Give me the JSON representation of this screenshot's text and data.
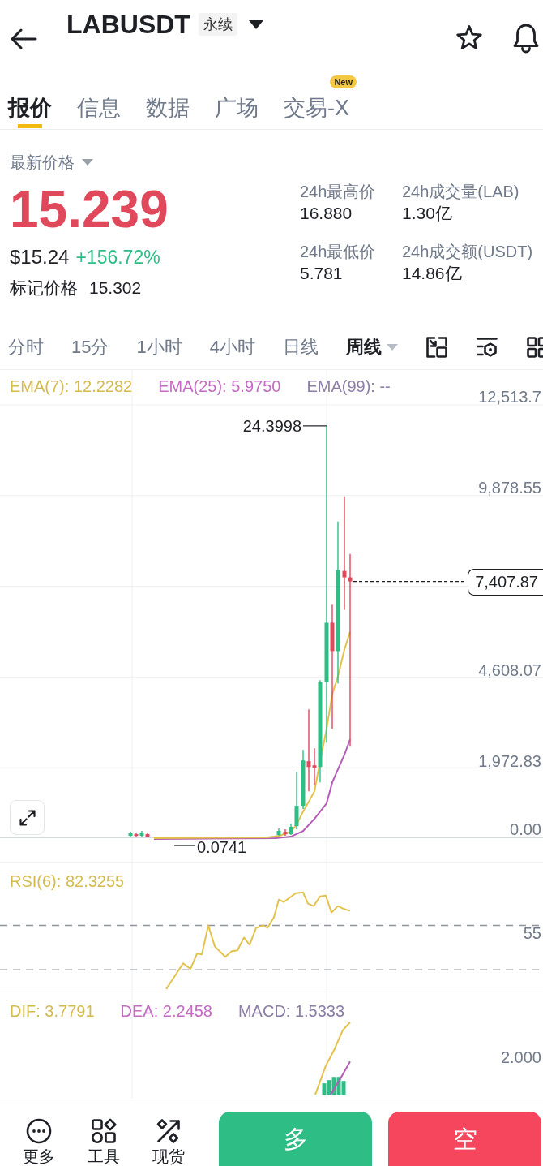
{
  "header": {
    "symbol": "LABUSDT",
    "contract_tag": "永续"
  },
  "tabs": [
    {
      "label": "报价",
      "selected": true
    },
    {
      "label": "信息",
      "selected": false
    },
    {
      "label": "数据",
      "selected": false
    },
    {
      "label": "广场",
      "selected": false
    },
    {
      "label": "交易-X",
      "selected": false,
      "badge": "New"
    }
  ],
  "price": {
    "label": "最新价格",
    "last": "15.239",
    "usd": "$15.24",
    "change": "+156.72%",
    "mark_label": "标记价格",
    "mark": "15.302"
  },
  "stats": [
    {
      "label": "24h最高价",
      "value": "16.880"
    },
    {
      "label": "24h成交量(LAB)",
      "value": "1.30亿"
    },
    {
      "label": "24h最低价",
      "value": "5.781"
    },
    {
      "label": "24h成交额(USDT)",
      "value": "14.86亿"
    }
  ],
  "intervals": [
    {
      "label": "分时",
      "selected": false
    },
    {
      "label": "15分",
      "selected": false
    },
    {
      "label": "1小时",
      "selected": false
    },
    {
      "label": "4小时",
      "selected": false
    },
    {
      "label": "日线",
      "selected": false
    },
    {
      "label": "周线",
      "selected": true
    }
  ],
  "chart": {
    "legend": [
      {
        "label": "EMA(7): 12.2282",
        "color": "#d4bb4e"
      },
      {
        "label": "EMA(25): 5.9750",
        "color": "#c46bc3"
      },
      {
        "label": "EMA(99): --",
        "color": "#8c7ea6"
      }
    ],
    "y_labels": [
      "12,513.7",
      "9,878.55",
      "4,608.07",
      "1,972.83",
      "0.00"
    ],
    "last_price": "7,407.87",
    "high_marker": "24.3998",
    "low_marker": "0.0741"
  },
  "rsi": {
    "legend": "RSI(6): 82.3255",
    "y_label": "55"
  },
  "macd": {
    "legend": [
      {
        "label": "DIF: 3.7791",
        "color": "#d4bb4e"
      },
      {
        "label": "DEA: 2.2458",
        "color": "#c46bc3"
      },
      {
        "label": "MACD: 1.5333",
        "color": "#8c7ea6"
      }
    ],
    "y_label": "2.000"
  },
  "bottom_bar": {
    "tools": [
      {
        "label": "更多",
        "kind": "more"
      },
      {
        "label": "工具",
        "kind": "tools"
      },
      {
        "label": "现货",
        "kind": "spot"
      }
    ],
    "actions": [
      {
        "label": "多",
        "kind": "long"
      },
      {
        "label": "空",
        "kind": "short"
      }
    ]
  }
}
